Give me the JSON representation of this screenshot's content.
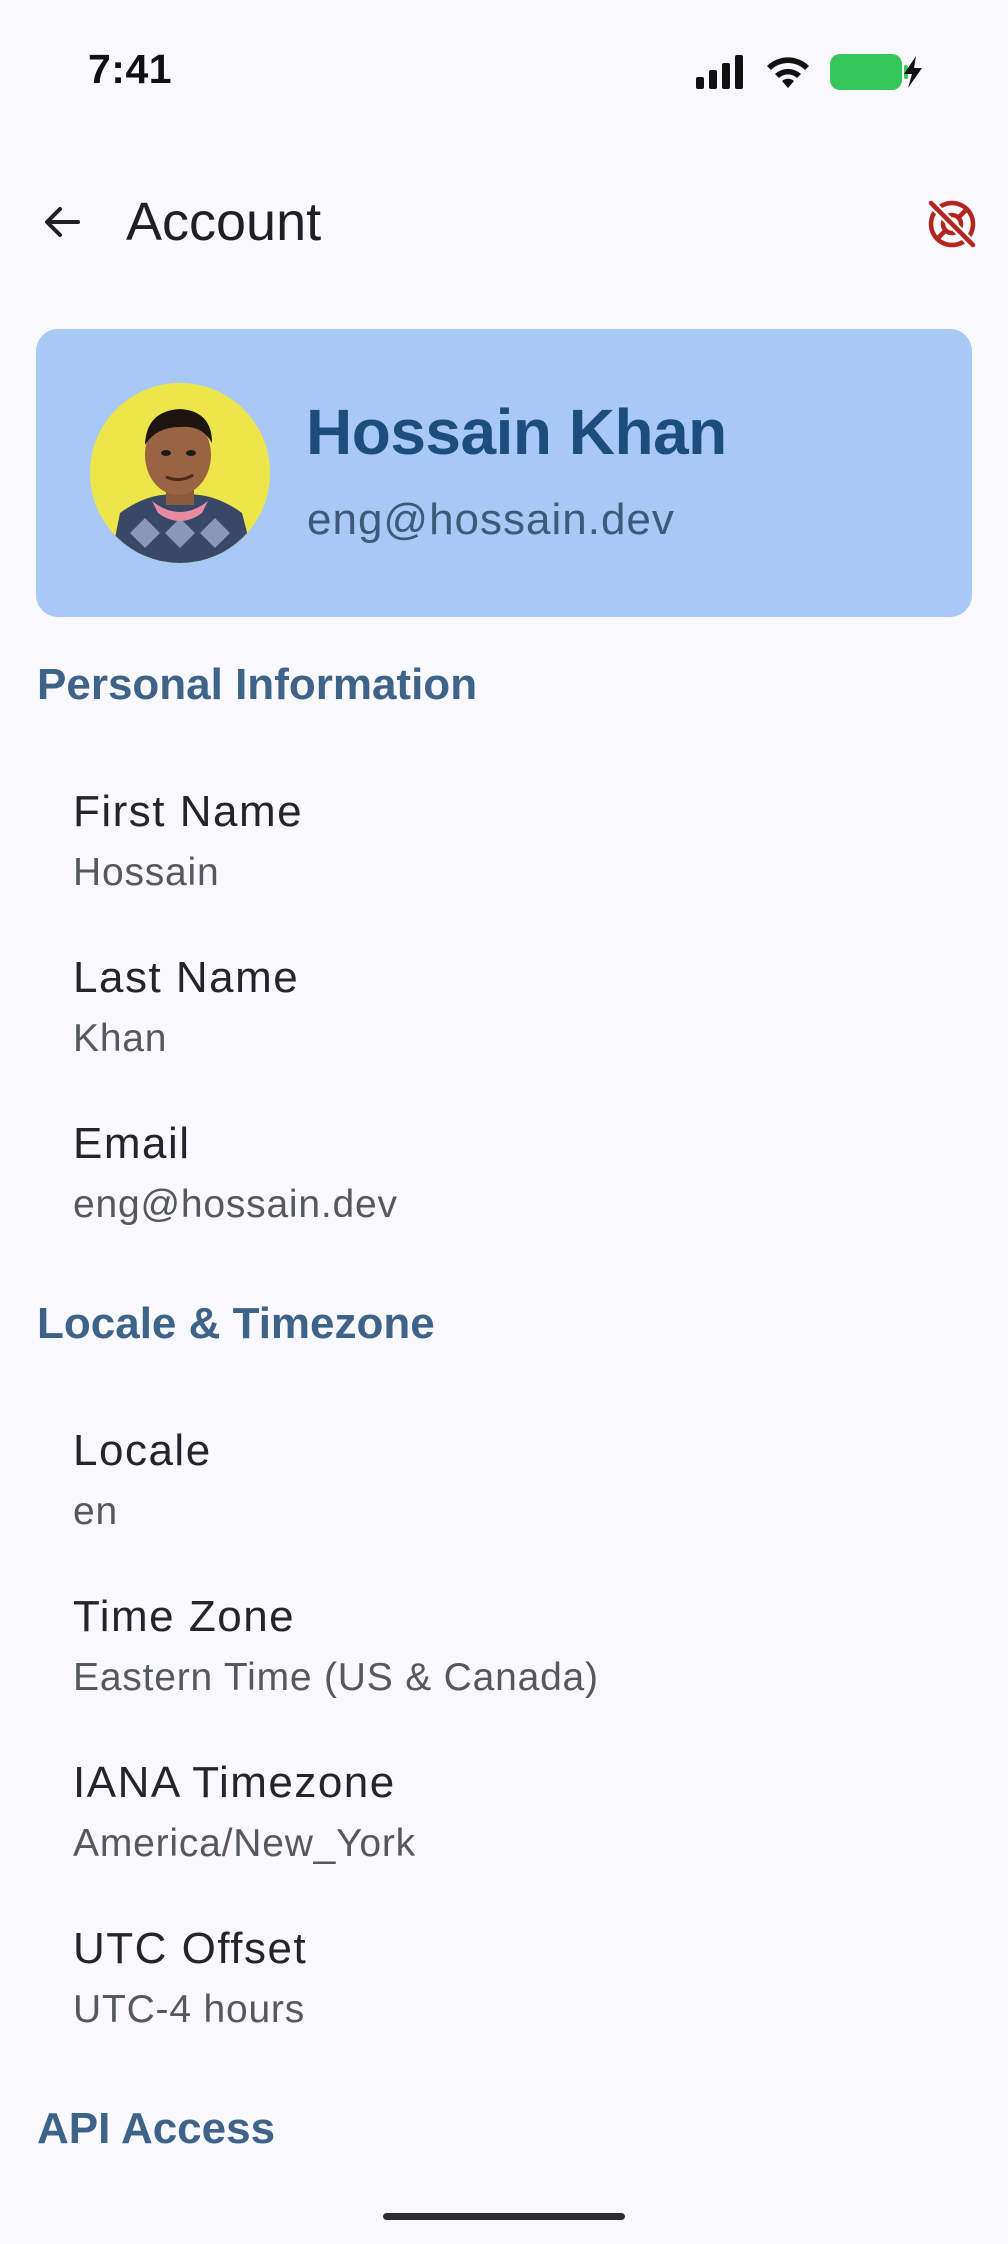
{
  "status_bar": {
    "time": "7:41"
  },
  "app_bar": {
    "title": "Account",
    "back_icon": "arrow-left-icon",
    "action_icon": "support-off-icon",
    "action_color": "#b3261e"
  },
  "profile": {
    "name": "Hossain Khan",
    "email": "eng@hossain.dev",
    "card_color": "#a8c8f5",
    "name_color": "#1d4d7f"
  },
  "sections": {
    "personal": {
      "title": "Personal Information",
      "fields": [
        {
          "label": "First Name",
          "value": "Hossain"
        },
        {
          "label": "Last Name",
          "value": "Khan"
        },
        {
          "label": "Email",
          "value": "eng@hossain.dev"
        }
      ]
    },
    "locale": {
      "title": "Locale & Timezone",
      "fields": [
        {
          "label": "Locale",
          "value": "en"
        },
        {
          "label": "Time Zone",
          "value": "Eastern Time (US & Canada)"
        },
        {
          "label": "IANA Timezone",
          "value": "America/New_York"
        },
        {
          "label": "UTC Offset",
          "value": "UTC-4 hours"
        }
      ]
    },
    "api": {
      "title": "API Access"
    }
  },
  "colors": {
    "section_title": "#3e6388",
    "background": "#f8f8fd"
  }
}
